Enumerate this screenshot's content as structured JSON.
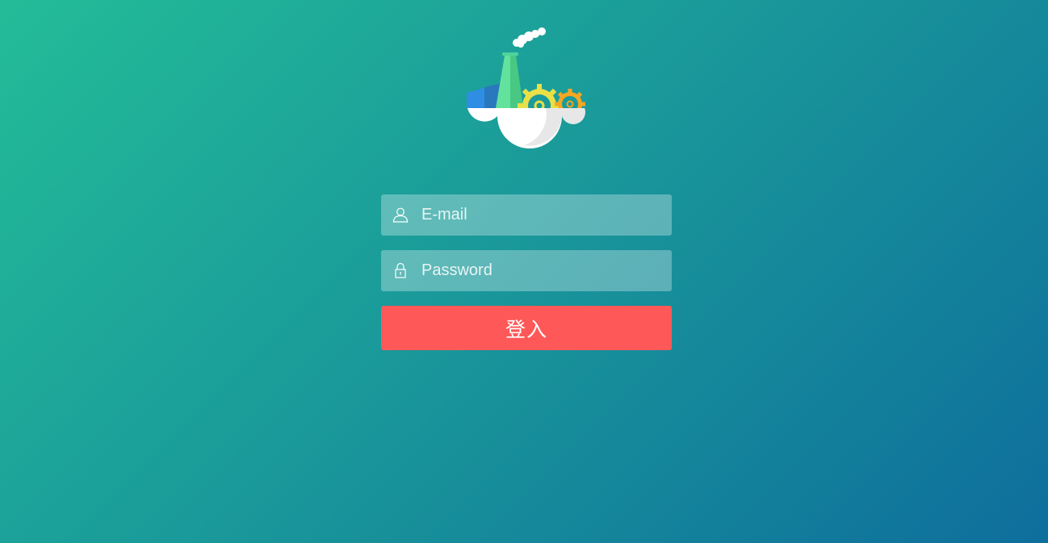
{
  "login": {
    "email_placeholder": "E-mail",
    "password_placeholder": "Password",
    "submit_label": "登入"
  },
  "icons": {
    "logo": "factory-cloud-logo",
    "email": "user-icon",
    "password": "lock-icon"
  },
  "colors": {
    "gradient_start": "#23bc98",
    "gradient_end": "#0e6e9c",
    "input_bg": "rgba(255,255,255,0.3)",
    "button_bg": "#ff5858",
    "text": "#ffffff"
  }
}
